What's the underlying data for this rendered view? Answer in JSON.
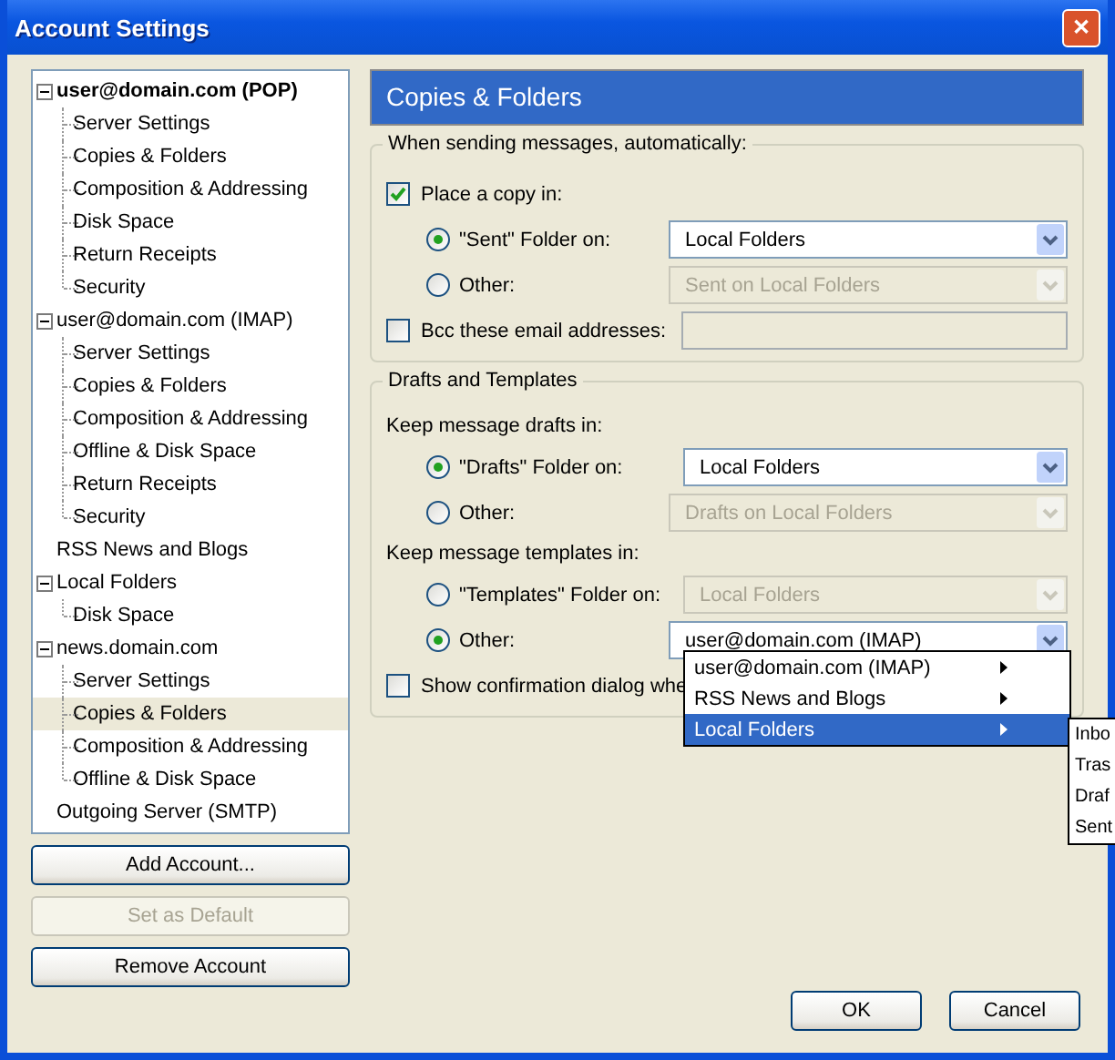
{
  "window": {
    "title": "Account Settings",
    "close": "✕"
  },
  "tree": [
    {
      "label": "user@domain.com  (POP)",
      "default": true,
      "expanded": true,
      "selected": false,
      "children": [
        {
          "label": "Server Settings",
          "selected": false
        },
        {
          "label": "Copies & Folders",
          "selected": false
        },
        {
          "label": "Composition & Addressing",
          "selected": false
        },
        {
          "label": "Disk Space",
          "selected": false
        },
        {
          "label": "Return Receipts",
          "selected": false
        },
        {
          "label": "Security",
          "selected": false
        }
      ]
    },
    {
      "label": "user@domain.com  (IMAP)",
      "default": false,
      "expanded": true,
      "selected": false,
      "children": [
        {
          "label": "Server Settings",
          "selected": false
        },
        {
          "label": "Copies & Folders",
          "selected": false
        },
        {
          "label": "Composition & Addressing",
          "selected": false
        },
        {
          "label": "Offline & Disk Space",
          "selected": false
        },
        {
          "label": "Return Receipts",
          "selected": false
        },
        {
          "label": "Security",
          "selected": false
        }
      ]
    },
    {
      "label": "RSS News and Blogs",
      "default": false,
      "selected": false
    },
    {
      "label": "Local Folders",
      "default": false,
      "expanded": true,
      "selected": false,
      "children": [
        {
          "label": "Disk Space",
          "selected": false
        }
      ]
    },
    {
      "label": "news.domain.com",
      "default": false,
      "expanded": true,
      "selected": false,
      "children": [
        {
          "label": "Server Settings",
          "selected": false
        },
        {
          "label": "Copies & Folders",
          "selected": true
        },
        {
          "label": "Composition & Addressing",
          "selected": false
        },
        {
          "label": "Offline & Disk Space",
          "selected": false
        }
      ]
    },
    {
      "label": "Outgoing Server (SMTP)",
      "default": false,
      "selected": false
    }
  ],
  "account_buttons": [
    {
      "label": "Add Account...",
      "disabled": false
    },
    {
      "label": "Set as Default",
      "disabled": true
    },
    {
      "label": "Remove Account",
      "disabled": false
    }
  ],
  "panel_title": "Copies & Folders",
  "groups": [
    {
      "legend": "When sending messages, automatically:",
      "rows": [
        {
          "kind": "checkbox",
          "label": "Place a copy in:",
          "checked": true
        },
        {
          "kind": "radio",
          "label": "\"Sent\" Folder on:",
          "selected": true,
          "value": "Local Folders",
          "disabled": false
        },
        {
          "kind": "radio",
          "label": "Other:",
          "selected": false,
          "value": "Sent on Local Folders",
          "disabled": true
        },
        {
          "kind": "checkbox-field",
          "label": "Bcc these email addresses:",
          "checked": false
        }
      ]
    },
    {
      "legend": "Drafts and Templates",
      "rows": [
        {
          "kind": "heading",
          "label": "Keep message drafts in:"
        },
        {
          "kind": "radio",
          "label": "\"Drafts\" Folder on:",
          "selected": true,
          "value": "Local Folders",
          "disabled": false
        },
        {
          "kind": "radio",
          "label": "Other:",
          "selected": false,
          "value": "Drafts on Local Folders",
          "disabled": true
        },
        {
          "kind": "heading",
          "label": "Keep message templates in:"
        },
        {
          "kind": "radio",
          "label": "\"Templates\" Folder on:",
          "selected": false,
          "value": "Local Folders",
          "disabled": true
        },
        {
          "kind": "radio",
          "label": "Other:",
          "selected": true,
          "value": "user@domain.com  (IMAP)",
          "disabled": false
        },
        {
          "kind": "checkbox",
          "label": "Show confirmation dialog whe",
          "checked": false
        }
      ]
    }
  ],
  "menu": [
    {
      "label": "user@domain.com  (IMAP)",
      "selected": false
    },
    {
      "label": "RSS News and Blogs",
      "selected": false
    },
    {
      "label": "Local Folders",
      "selected": true
    }
  ],
  "submenu": [
    "Inbo",
    "Tras",
    "Draf",
    "Sent"
  ],
  "dialog_buttons": [
    "OK",
    "Cancel"
  ]
}
